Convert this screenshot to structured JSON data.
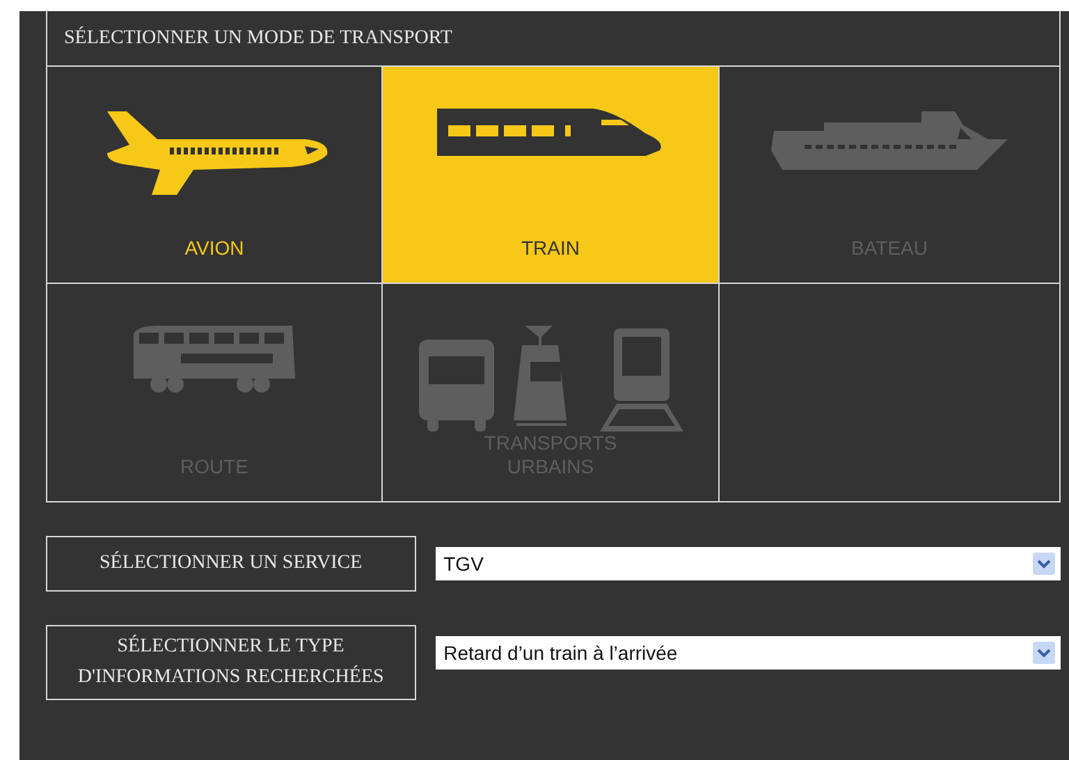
{
  "panel": {
    "title": "SÉLECTIONNER UN MODE DE TRANSPORT"
  },
  "modes": [
    {
      "kind": "plane",
      "label": "AVION",
      "selected": false,
      "disabled": false
    },
    {
      "kind": "train",
      "label": "TRAIN",
      "selected": true,
      "disabled": false
    },
    {
      "kind": "ship",
      "label": "BATEAU",
      "selected": false,
      "disabled": true
    },
    {
      "kind": "bus",
      "label": "ROUTE",
      "selected": false,
      "disabled": true
    },
    {
      "kind": "urban",
      "label": "TRANSPORTS URBAINS",
      "selected": false,
      "disabled": true
    }
  ],
  "fields": [
    {
      "label": "SÉLECTIONNER UN SERVICE",
      "value": "TGV"
    },
    {
      "label": "SÉLECTIONNER LE TYPE D'INFORMATIONS RECHERCHÉES",
      "value": "Retard d’un train à l’arrivée"
    }
  ]
}
